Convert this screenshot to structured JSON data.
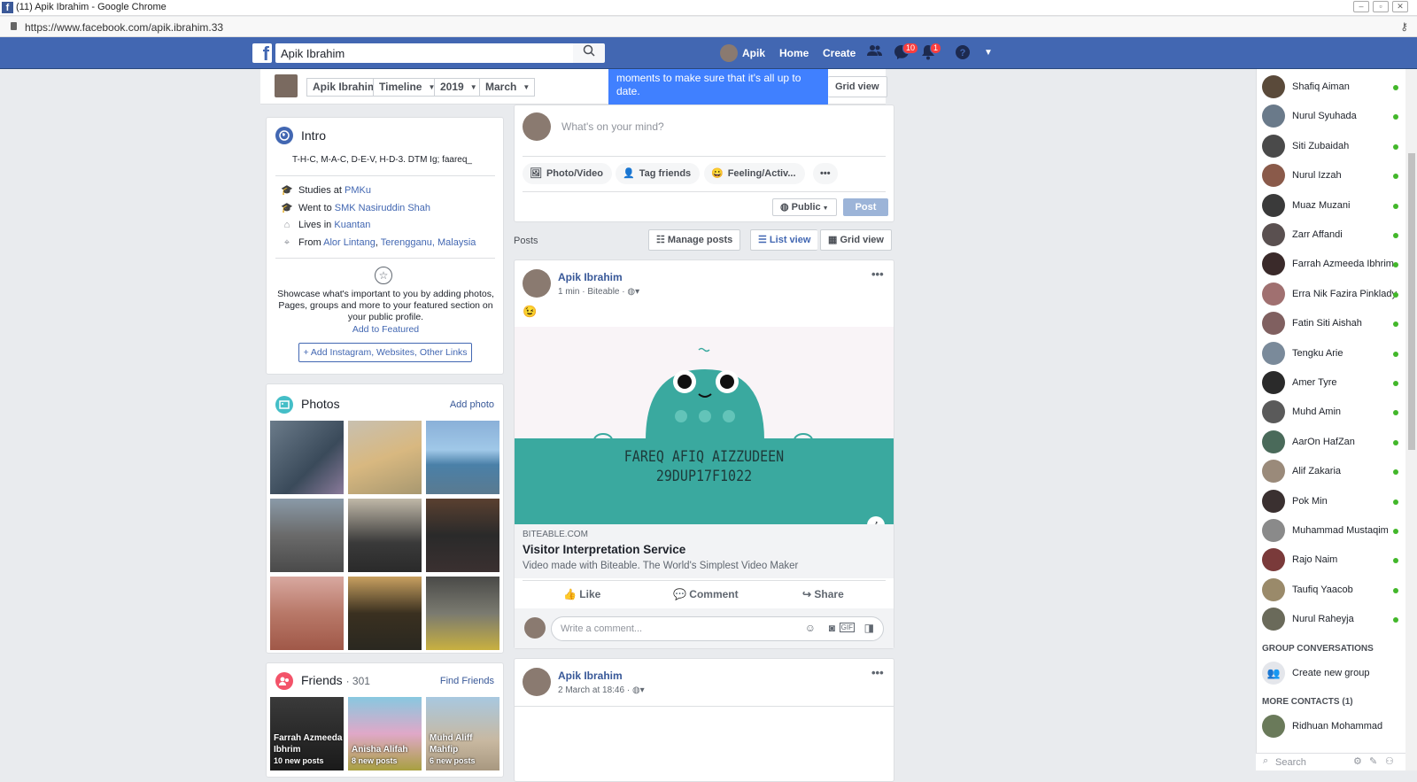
{
  "browser": {
    "tab_title": "(11) Apik Ibrahim - Google Chrome",
    "url": "https://www.facebook.com/apik.ibrahim.33"
  },
  "topbar": {
    "search_value": "Apik Ibrahim",
    "profile_name": "Apik",
    "home": "Home",
    "create": "Create",
    "messages_badge": "10",
    "notifications_badge": "1"
  },
  "sticky": {
    "name": "Apik Ibrahim",
    "timeline": "Timeline",
    "year": "2019",
    "month": "March",
    "grid_view": "Grid view"
  },
  "tooltip": {
    "text": "moments to make sure that it's all up to date."
  },
  "intro": {
    "title": "Intro",
    "bio": "T-H-C, M-A-C, D-E-V, H-D-3. DTM   Ig; faareq_",
    "studies_prefix": "Studies at",
    "studies_link": "PMKu",
    "went_prefix": "Went to",
    "went_link": "SMK Nasiruddin Shah",
    "lives_prefix": "Lives in",
    "lives_link": "Kuantan",
    "from_prefix": "From",
    "from_link1": "Alor Lintang",
    "from_link2": "Terengganu, Malaysia",
    "featured_text": "Showcase what's important to you by adding photos, Pages, groups and more to your featured section on your public profile.",
    "add_featured": "Add to Featured",
    "add_links": "Add Instagram, Websites, Other Links"
  },
  "photos": {
    "title": "Photos",
    "add_photo": "Add photo"
  },
  "friends": {
    "title": "Friends",
    "count": "· 301",
    "find": "Find Friends",
    "list": [
      {
        "name1": "Farrah Azmeeda",
        "name2": "Ibhrim",
        "posts": "10 new posts"
      },
      {
        "name1": "Anisha Alifah",
        "name2": "",
        "posts": "8 new posts"
      },
      {
        "name1": "Muhd Aliff",
        "name2": "Mahfip",
        "posts": "6 new posts"
      }
    ]
  },
  "composer": {
    "placeholder": "What's on your mind?",
    "photo_video": "Photo/Video",
    "tag_friends": "Tag friends",
    "feeling": "Feeling/Activ...",
    "more": "•••",
    "public": "Public",
    "post": "Post"
  },
  "posts_bar": {
    "label": "Posts",
    "manage": "Manage posts",
    "list_view": "List view",
    "grid_view": "Grid view"
  },
  "post1": {
    "author": "Apik Ibrahim",
    "meta": "1 min · Biteable ·",
    "emoji": "😉",
    "video_line1": "FAREQ AFIQ AIZZUDEEN",
    "video_line2": "29DUP17F1022",
    "link_domain": "BITEABLE.COM",
    "link_title": "Visitor Interpretation Service",
    "link_desc": "Video made with Biteable. The World's Simplest Video Maker",
    "like": "Like",
    "comment": "Comment",
    "share": "Share",
    "comment_placeholder": "Write a comment..."
  },
  "post2": {
    "author": "Apik Ibrahim",
    "meta": "2 March at 18:46 ·"
  },
  "chat": {
    "contacts": [
      "Shafiq Aiman",
      "Nurul Syuhada",
      "Siti Zubaidah",
      "Nurul Izzah",
      "Muaz Muzani",
      "Zarr Affandi",
      "Farrah Azmeeda Ibhrim",
      "Erra Nik Fazira Pinklady",
      "Fatin Siti Aishah",
      "Tengku Arie",
      "Amer Tyre",
      "Muhd Amin",
      "AarOn HafZan",
      "Alif Zakaria",
      "Pok Min",
      "Muhammad Mustaqim",
      "Rajo Naim",
      "Taufiq Yaacob",
      "Nurul Raheyja"
    ],
    "group_header": "GROUP CONVERSATIONS",
    "create_group": "Create new group",
    "more_header": "MORE CONTACTS (1)",
    "more_contact": "Ridhuan Mohammad",
    "search_placeholder": "Search"
  },
  "colors": {
    "fb_blue": "#4267b2",
    "link": "#385898",
    "online": "#42b72a",
    "tooltip": "#4080ff",
    "video_teal": "#3aa99f"
  }
}
